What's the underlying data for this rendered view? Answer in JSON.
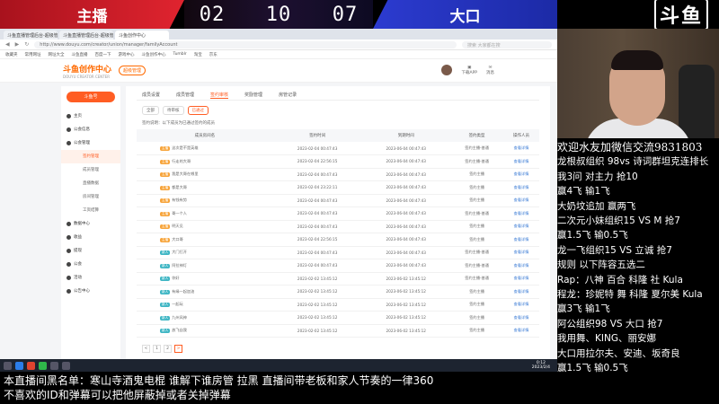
{
  "vs": {
    "left_name": "主播",
    "right_name": "大口",
    "time_h": "02",
    "time_m": "10",
    "time_s": "07"
  },
  "logo": "斗鱼",
  "browser": {
    "tabs": [
      "斗鱼直播管理后台-超级管理...",
      "斗鱼直播管理后台-超级管理...",
      "斗鱼创作中心"
    ],
    "url": "http://www.douyu.com/creator/union/manager/familyAccount",
    "search_placeholder": "搜索 大家都在搜",
    "bookmarks": [
      "收藏夹",
      "常用网址",
      "网址大全",
      "斗鱼直播",
      "百度一下",
      "游戏中心",
      "斗鱼创作中心",
      "Tumblr",
      "淘宝",
      "京东"
    ]
  },
  "site": {
    "brand": "斗鱼创作中心",
    "brand_sub": "DOUYU CREATOR CENTER",
    "badge": "超级管理",
    "header_items": [
      "下载APP",
      "消息"
    ]
  },
  "sidebar": {
    "button": "斗鱼号",
    "items": [
      {
        "label": "主页",
        "sub": false,
        "active": false
      },
      {
        "label": "公会信息",
        "sub": false,
        "active": false
      },
      {
        "label": "公会管理",
        "sub": false,
        "active": false
      },
      {
        "label": "签约管理",
        "sub": true,
        "active": true
      },
      {
        "label": "成员管理",
        "sub": true,
        "active": false
      },
      {
        "label": "直播数据",
        "sub": true,
        "active": false
      },
      {
        "label": "房间管理",
        "sub": true,
        "active": false
      },
      {
        "label": "工资结算",
        "sub": true,
        "active": false
      },
      {
        "label": "数据中心",
        "sub": false,
        "active": false
      },
      {
        "label": "收益",
        "sub": false,
        "active": false
      },
      {
        "label": "提现",
        "sub": false,
        "active": false
      },
      {
        "label": "公会",
        "sub": false,
        "active": false
      },
      {
        "label": "活动",
        "sub": false,
        "active": false
      },
      {
        "label": "公告中心",
        "sub": false,
        "active": false
      }
    ]
  },
  "main": {
    "tabs": [
      "成员设置",
      "成员管理",
      "签约审核",
      "奖励管理",
      "房管记录"
    ],
    "active_tab": 2,
    "filters": [
      "全部",
      "待审核",
      "已通过"
    ],
    "active_filter": 2,
    "note": "签约说明：以下成员为已通过签约的成员",
    "columns": [
      "成员房间名",
      "签约时间",
      "到期时间",
      "签约类型",
      "操作人员"
    ],
    "rows": [
      {
        "tag": "主播",
        "tag_color": "orange",
        "name": "这次是不是英雄",
        "start": "2023-02-04 00:47:43",
        "end": "2023-06-04 00:47:43",
        "type": "签约主播-普通",
        "action": "查看详情"
      },
      {
        "tag": "主播",
        "tag_color": "orange",
        "name": "行走的大哥",
        "start": "2023-02-04 22:56:15",
        "end": "2023-06-04 00:47:43",
        "type": "签约主播-普通",
        "action": "查看详情"
      },
      {
        "tag": "主播",
        "tag_color": "orange",
        "name": "我是大哥在哪里",
        "start": "2023-02-04 00:47:43",
        "end": "2023-06-04 00:47:43",
        "type": "签约主播",
        "action": "查看详情"
      },
      {
        "tag": "主播",
        "tag_color": "orange",
        "name": "都是大哥",
        "start": "2023-02-04 23:22:11",
        "end": "2023-06-04 00:47:43",
        "type": "签约主播",
        "action": "查看详情"
      },
      {
        "tag": "主播",
        "tag_color": "orange",
        "name": "有钱有势",
        "start": "2023-02-04 00:47:43",
        "end": "2023-06-04 00:47:43",
        "type": "签约主播",
        "action": "查看详情"
      },
      {
        "tag": "主播",
        "tag_color": "orange",
        "name": "哥一个人",
        "start": "2023-02-04 00:47:43",
        "end": "2023-06-04 00:47:43",
        "type": "签约主播-普通",
        "action": "查看详情"
      },
      {
        "tag": "主播",
        "tag_color": "orange",
        "name": "明天见",
        "start": "2023-02-04 00:47:43",
        "end": "2023-06-04 00:47:43",
        "type": "签约主播",
        "action": "查看详情"
      },
      {
        "tag": "主播",
        "tag_color": "orange",
        "name": "大口哥",
        "start": "2023-02-04 22:56:15",
        "end": "2023-06-04 00:47:43",
        "type": "签约主播",
        "action": "查看详情"
      },
      {
        "tag": "新人",
        "tag_color": "cyan",
        "name": "大门打开",
        "start": "2023-02-04 00:47:43",
        "end": "2023-06-04 00:47:43",
        "type": "签约主播-普通",
        "action": "查看详情"
      },
      {
        "tag": "新人",
        "tag_color": "cyan",
        "name": "阿拉神灯",
        "start": "2023-02-04 00:47:43",
        "end": "2023-06-04 00:47:43",
        "type": "签约主播-普通",
        "action": "查看详情"
      },
      {
        "tag": "新人",
        "tag_color": "cyan",
        "name": "你好",
        "start": "2023-02-02 13:45:12",
        "end": "2023-06-02 13:45:12",
        "type": "签约主播-普通",
        "action": "查看详情"
      },
      {
        "tag": "新人",
        "tag_color": "cyan",
        "name": "有缘一起加油",
        "start": "2023-02-02 13:45:12",
        "end": "2023-06-02 13:45:12",
        "type": "签约主播",
        "action": "查看详情"
      },
      {
        "tag": "新人",
        "tag_color": "cyan",
        "name": "一起玩",
        "start": "2023-02-02 13:45:12",
        "end": "2023-06-02 13:45:12",
        "type": "签约主播",
        "action": "查看详情"
      },
      {
        "tag": "新人",
        "tag_color": "cyan",
        "name": "九州风神",
        "start": "2023-02-02 13:45:12",
        "end": "2023-06-02 13:45:12",
        "type": "签约主播",
        "action": "查看详情"
      },
      {
        "tag": "新人",
        "tag_color": "cyan",
        "name": "放飞自我",
        "start": "2023-02-02 13:45:12",
        "end": "2023-06-02 13:45:12",
        "type": "签约主播",
        "action": "查看详情"
      }
    ],
    "pages": [
      "<",
      "1",
      "2",
      ">"
    ],
    "active_page": 1
  },
  "taskbar": {
    "time": "0:12",
    "date": "2023/2/4"
  },
  "chat": {
    "lines": [
      "欢迎水友加微信交流9831803",
      "龙根叔组织 98vs 诗词群坦克连排长",
      "我3问 对主力 抢10",
      "赢4飞 输1飞",
      "大奶坟追加 赢两飞",
      "二次元小妹组织15 VS M 抢7",
      "赢1.5飞 输0.5飞",
      "龙一飞组织15 VS 立诚 抢7",
      "规则 以下阵容五选二",
      "Rap：八神 百合 科隆 社 Kula",
      "程龙：珍妮特 舞 科隆 夏尔美 Kula",
      "赢3飞 输1飞",
      "阿公组织98 VS 大口 抢7",
      "我用舞、KING、丽安娜",
      "大口用拉尔夫、安迪、坂奇良",
      "赢1.5飞 输0.5飞"
    ]
  },
  "banner": {
    "line1": "本直播间黑名单：寒山寺酒鬼电棍 谁解下谁房管 拉黑   直播间带老板和家人节奏的一律360",
    "line2": "不喜欢的ID和弹幕可以把他屏蔽掉或者关掉弹幕"
  }
}
